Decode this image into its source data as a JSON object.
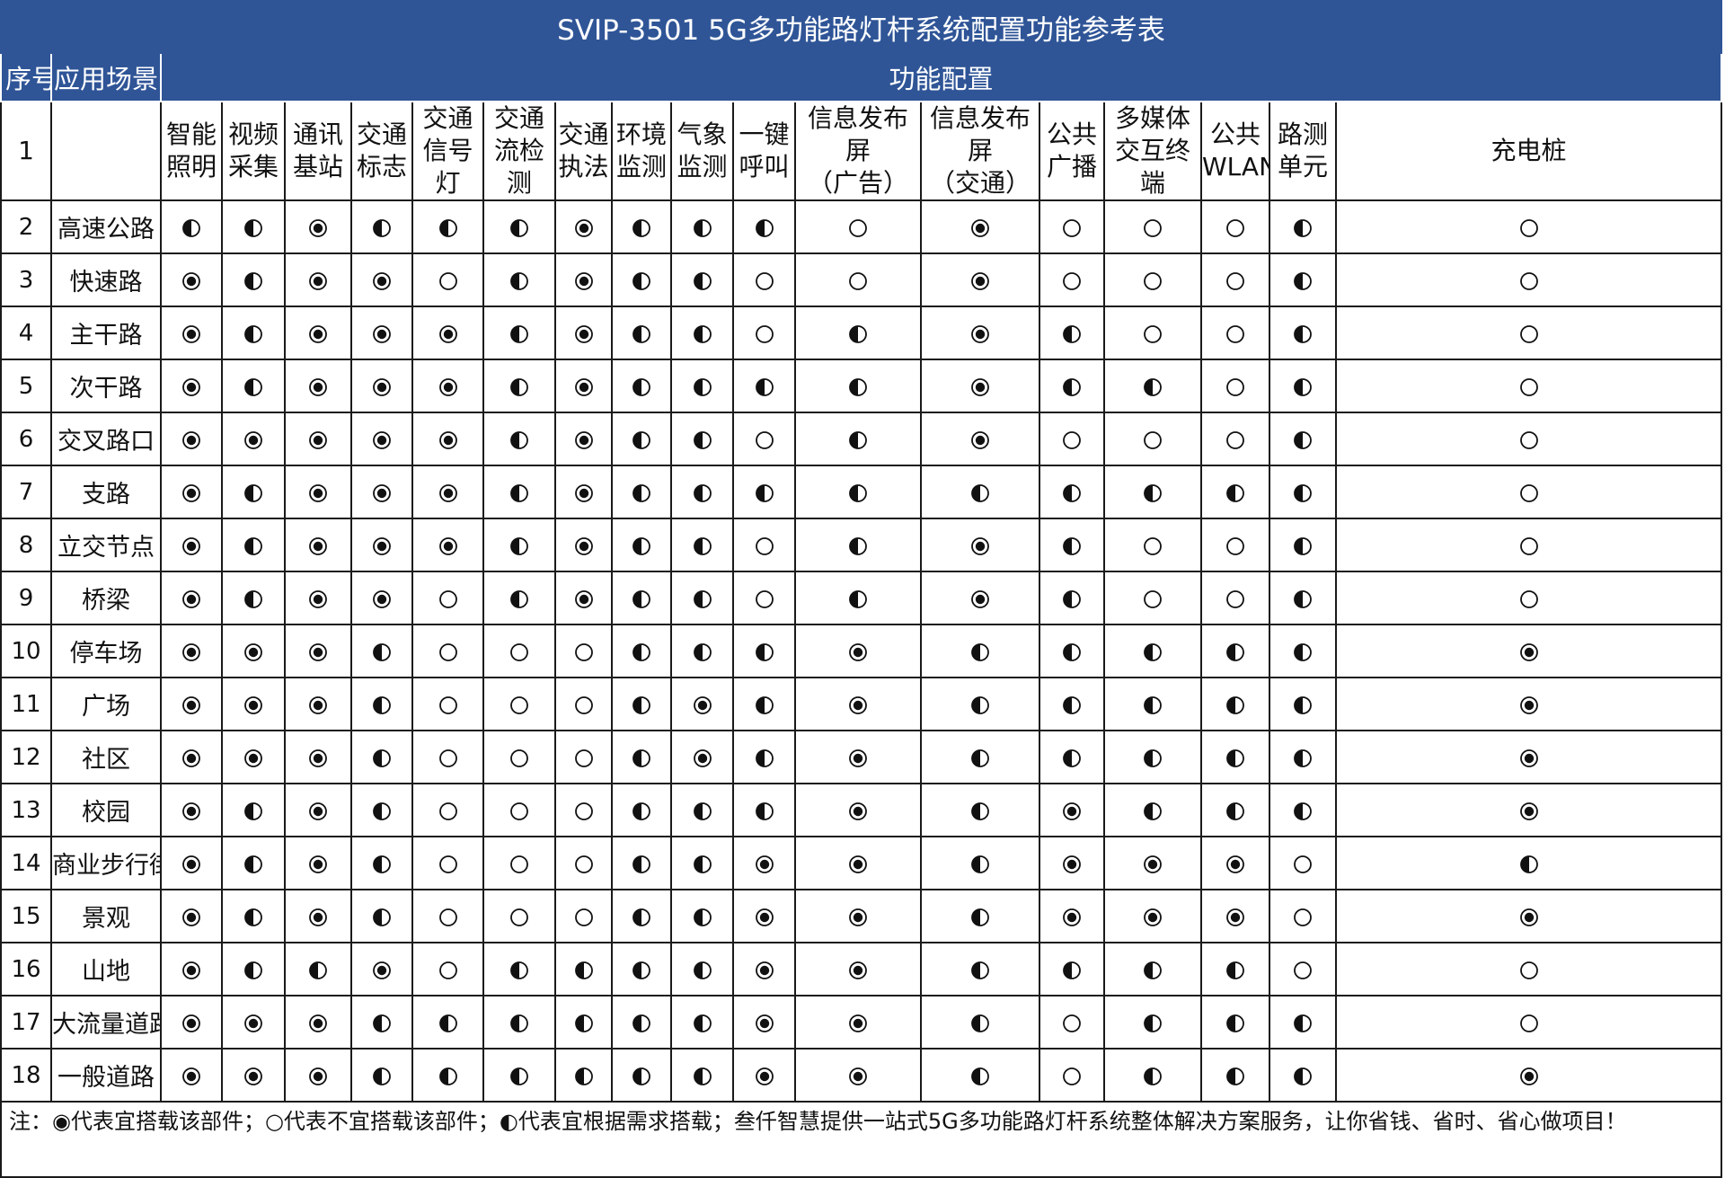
{
  "title": "SVIP-3501 5G多功能路灯杆系统配置功能参考表",
  "header": {
    "seq": "序号",
    "scenario": "应用场景",
    "function_config": "功能配置"
  },
  "feature_row_number": "1",
  "features": [
    [
      "智能",
      "照明"
    ],
    [
      "视频",
      "采集"
    ],
    [
      "通讯",
      "基站"
    ],
    [
      "交通",
      "标志"
    ],
    [
      "交通",
      "信号灯"
    ],
    [
      "交通",
      "流检测"
    ],
    [
      "交通",
      "执法"
    ],
    [
      "环境",
      "监测"
    ],
    [
      "气象",
      "监测"
    ],
    [
      "一键",
      "呼叫"
    ],
    [
      "信息发布屏",
      "（广告）"
    ],
    [
      "信息发布屏",
      "（交通）"
    ],
    [
      "公共",
      "广播"
    ],
    [
      "多媒体",
      "交互终端"
    ],
    [
      "公共",
      "WLAN"
    ],
    [
      "路测",
      "单元"
    ],
    [
      "充电桩"
    ]
  ],
  "symbols": {
    "Y": "◉",
    "N": "○",
    "O": "◐"
  },
  "rows": [
    {
      "seq": "2",
      "scenario": "高速公路",
      "values": "OOYOOOYOOONYNNNON"
    },
    {
      "seq": "3",
      "scenario": "快速路",
      "values": "YOYYNOYOONNYNNNON"
    },
    {
      "seq": "4",
      "scenario": "主干路",
      "values": "YOYYYOYOONOYONNON"
    },
    {
      "seq": "5",
      "scenario": "次干路",
      "values": "YOYYYOYOOOOYOONON"
    },
    {
      "seq": "6",
      "scenario": "交叉路口",
      "values": "YYYYYOYOONOYNNNON"
    },
    {
      "seq": "7",
      "scenario": "支路",
      "values": "YOYYYOYOOOOOOOOON"
    },
    {
      "seq": "8",
      "scenario": "立交节点",
      "values": "YOYYYOYOONOYONNON"
    },
    {
      "seq": "9",
      "scenario": "桥梁",
      "values": "YOYYNOYOONOYONNON"
    },
    {
      "seq": "10",
      "scenario": "停车场",
      "values": "YYYONNNOOOYOOOOOY"
    },
    {
      "seq": "11",
      "scenario": "广场",
      "values": "YYYONNNOYOYOOOOOY"
    },
    {
      "seq": "12",
      "scenario": "社区",
      "values": "YYYONNNOYOYOOOOOY"
    },
    {
      "seq": "13",
      "scenario": "校园",
      "values": "YOYONNNOOOYOYOOOY"
    },
    {
      "seq": "14",
      "scenario": "商业步行街",
      "values": "YOYONNNOOYYOYYYNO"
    },
    {
      "seq": "15",
      "scenario": "景观",
      "values": "YOYONNNOOYYOYYYNY"
    },
    {
      "seq": "16",
      "scenario": "山地",
      "values": "YOOYNOOOOYYOOOONN"
    },
    {
      "seq": "17",
      "scenario": "大流量道路",
      "values": "YYYOOOOOOYYONOOON"
    },
    {
      "seq": "18",
      "scenario": "一般道路",
      "values": "YYYOOOOOOYYONOOOY"
    }
  ],
  "note": "注：◉代表宜搭载该部件；○代表不宜搭载该部件；◐代表宜根据需求搭载；叁仟智慧提供一站式5G多功能路灯杆系统整体解决方案服务，让你省钱、省时、省心做项目！"
}
